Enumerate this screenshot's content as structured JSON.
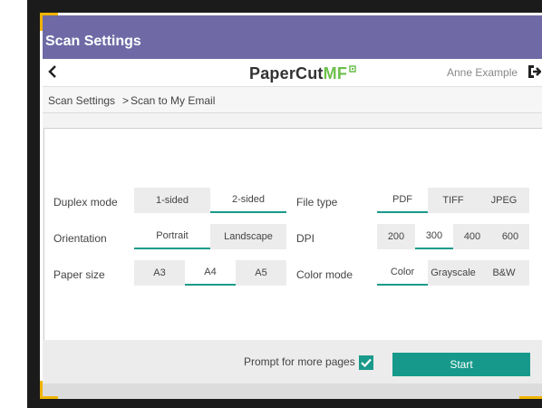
{
  "window": {
    "title": "Scan Settings"
  },
  "appbar": {
    "back_icon": "chevron-left-icon",
    "logo_main": "PaperCut",
    "logo_accent": "MF",
    "user_name": "Anne Example",
    "logout_icon": "logout-icon"
  },
  "breadcrumb": {
    "root": "Scan Settings",
    "separator": ">",
    "current": "Scan to My Email"
  },
  "settings": {
    "duplex": {
      "label": "Duplex mode",
      "options": [
        "1-sided",
        "2-sided"
      ],
      "selected": "2-sided"
    },
    "orientation": {
      "label": "Orientation",
      "options": [
        "Portrait",
        "Landscape"
      ],
      "selected": "Portrait"
    },
    "paper_size": {
      "label": "Paper size",
      "options": [
        "A3",
        "A4",
        "A5"
      ],
      "selected": "A4"
    },
    "file_type": {
      "label": "File type",
      "options": [
        "PDF",
        "TIFF",
        "JPEG"
      ],
      "selected": "PDF"
    },
    "dpi": {
      "label": "DPI",
      "options": [
        "200",
        "300",
        "400",
        "600"
      ],
      "selected": "300"
    },
    "color_mode": {
      "label": "Color mode",
      "options": [
        "Color",
        "Grayscale",
        "B&W"
      ],
      "selected": "Color"
    }
  },
  "footer": {
    "prompt_label": "Prompt for more pages",
    "prompt_checked": true,
    "start_label": "Start"
  },
  "colors": {
    "header_bar": "#6f6aa6",
    "accent_teal": "#16998a",
    "logo_green": "#6cc04a",
    "bezel": "#1b1b1b",
    "corner_marker": "#f0b400"
  }
}
